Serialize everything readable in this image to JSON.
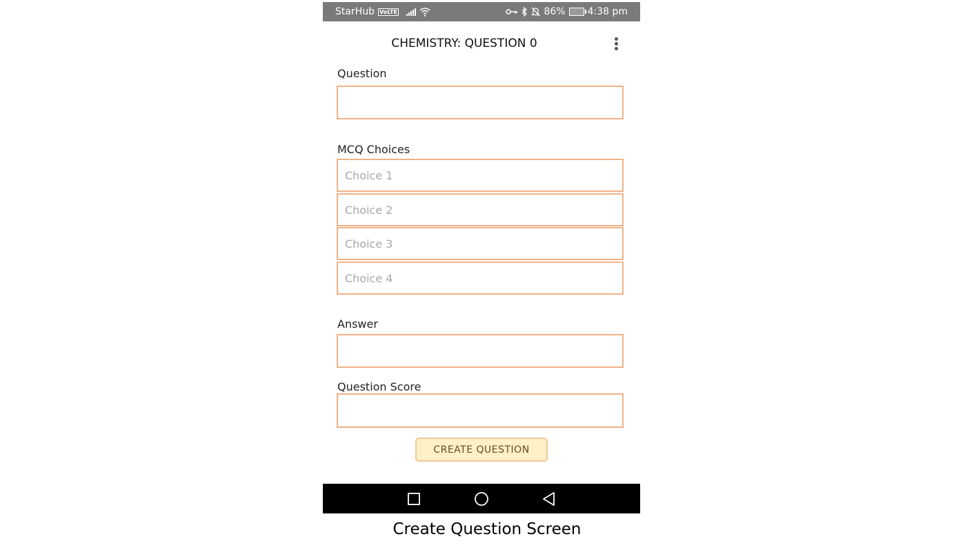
{
  "statusbar": {
    "carrier": "StarHub",
    "volte": "VoLTE",
    "battery": "86%",
    "time": "4:38 pm"
  },
  "appbar": {
    "title": "CHEMISTRY: QUESTION 0"
  },
  "form": {
    "question_label": "Question",
    "question_value": "",
    "choices_label": "MCQ Choices",
    "choices": [
      {
        "placeholder": "Choice 1",
        "value": ""
      },
      {
        "placeholder": "Choice 2",
        "value": ""
      },
      {
        "placeholder": "Choice 3",
        "value": ""
      },
      {
        "placeholder": "Choice 4",
        "value": ""
      }
    ],
    "answer_label": "Answer",
    "answer_value": "",
    "score_label": "Question Score",
    "score_value": "",
    "create_button": "CREATE QUESTION"
  },
  "caption": "Create Question Screen",
  "colors": {
    "statusbar": "#7a7a7a",
    "field_border": "#f1b185",
    "button_bg": "#fff0c8",
    "button_border": "#f0c89a",
    "navbar": "#000000"
  }
}
